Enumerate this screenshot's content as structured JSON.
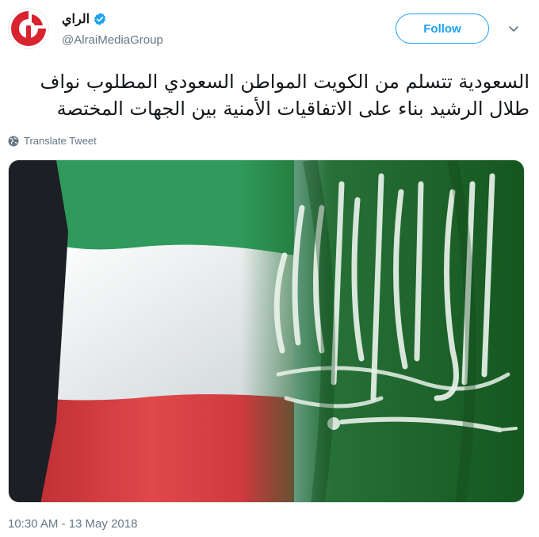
{
  "header": {
    "display_name": "الراي",
    "handle": "@AlraiMediaGroup",
    "follow_label": "Follow"
  },
  "tweet": {
    "text": "السعودية تتسلم من الكويت المواطن السعودي المطلوب نواف طلال الرشيد بناء على الاتفاقيات الأمنية بين الجهات المختصة",
    "translate_label": "Translate Tweet",
    "timestamp": "10:30 AM - 13 May 2018"
  },
  "media": {
    "description_icon": "kuwait-saudi-flags-image",
    "colors": {
      "kuwait_green": "#2f9a5b",
      "kuwait_white": "#e9eef0",
      "kuwait_red": "#d23a3a",
      "kuwait_black": "#1c1f24",
      "saudi_green": "#1f6b2e"
    }
  },
  "colors": {
    "accent": "#1da1f2",
    "secondary_text": "#657786",
    "brand_red": "#d9232e"
  }
}
